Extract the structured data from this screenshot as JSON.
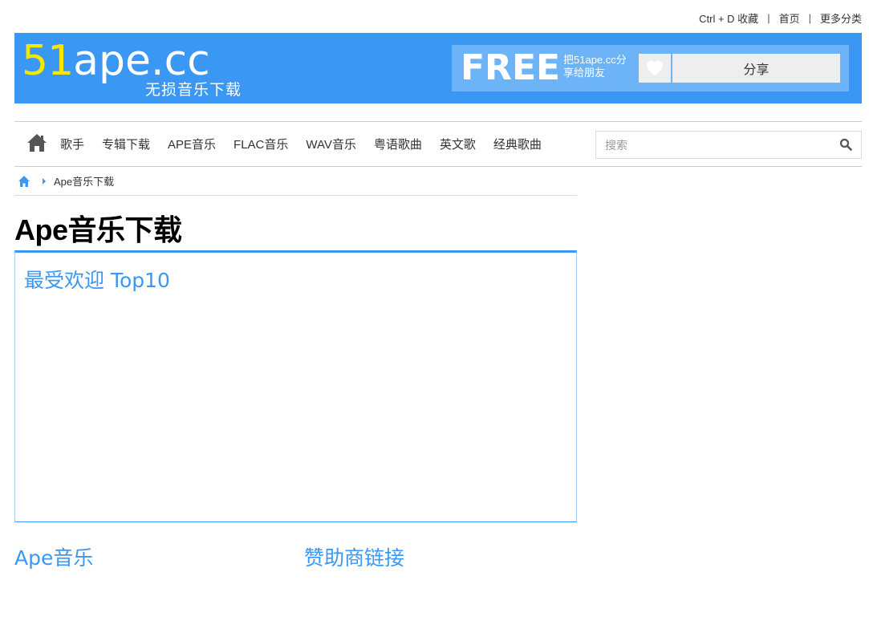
{
  "toplinks": {
    "bookmark": "Ctrl + D 收藏",
    "sep": "|",
    "home": "首页",
    "more": "更多分类"
  },
  "banner": {
    "logo_num": "51",
    "logo_text": "ape.cc",
    "tagline": "无损音乐下载",
    "free": "FREE",
    "free_text": "把51ape.cc分享给朋友",
    "share_label": "分享"
  },
  "nav": {
    "items": [
      "歌手",
      "专辑下载",
      "APE音乐",
      "FLAC音乐",
      "WAV音乐",
      "粤语歌曲",
      "英文歌",
      "经典歌曲"
    ]
  },
  "search": {
    "placeholder": "搜索"
  },
  "breadcrumb": {
    "current": "Ape音乐下载"
  },
  "page": {
    "title": "Ape音乐下载",
    "top10_heading": "最受欢迎 Top10",
    "section_ape": "Ape音乐",
    "section_sponsor": "赞助商链接"
  },
  "colors": {
    "accent": "#3b97f4",
    "logo_yellow": "#f7e600"
  }
}
